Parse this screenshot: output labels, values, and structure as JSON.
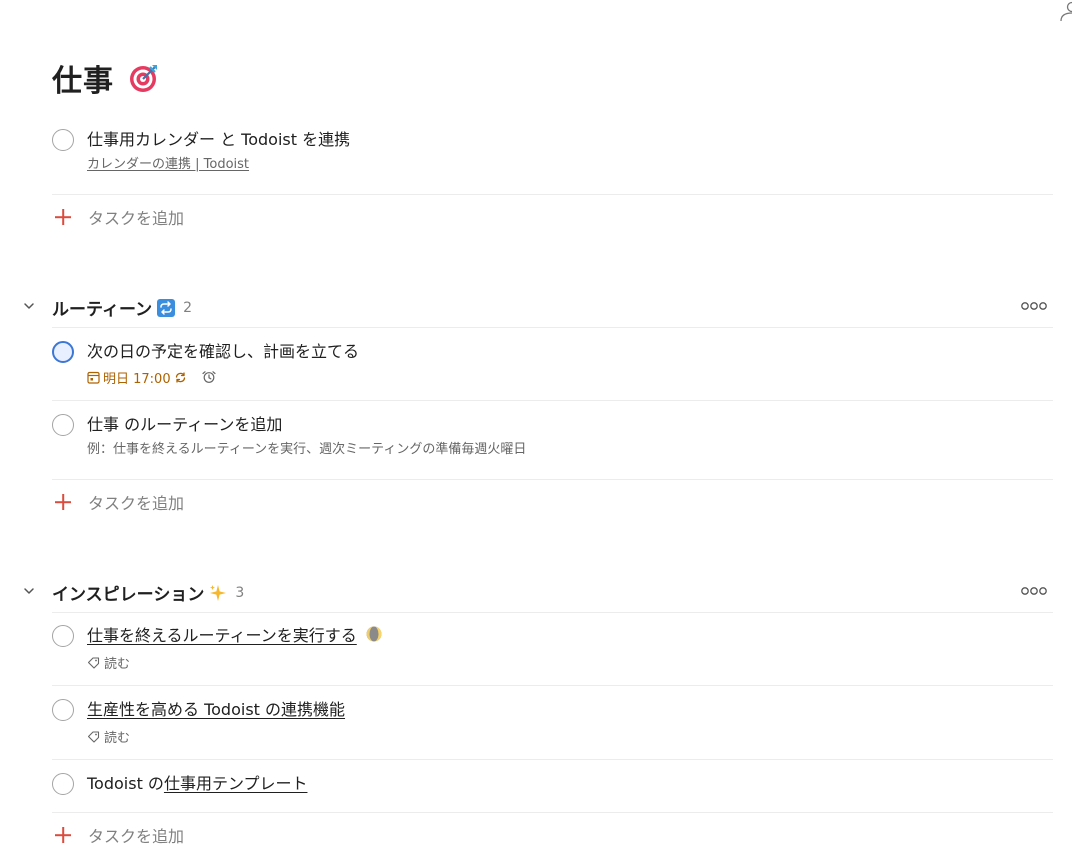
{
  "project": {
    "title": "仕事",
    "title_emoji": "direct-hit-icon"
  },
  "inbox_section": {
    "tasks": [
      {
        "title": "仕事用カレンダー と Todoist を連携",
        "subtitle": "カレンダーの連携 | Todoist"
      }
    ],
    "add_task_label": "タスクを追加"
  },
  "sections": [
    {
      "name": "ルーティーン",
      "emoji": "repeat-icon",
      "count": "2",
      "tasks": [
        {
          "title": "次の日の予定を確認し、計画を立てる",
          "priority": "p2",
          "due": "明日 17:00",
          "recurring": true,
          "reminder": true
        },
        {
          "title": "仕事 のルーティーンを追加",
          "description": "例：仕事を終えるルーティーンを実行、週次ミーティングの準備毎週火曜日"
        }
      ],
      "add_task_label": "タスクを追加"
    },
    {
      "name": "インスピレーション",
      "emoji": "sparkles-icon",
      "count": "3",
      "tasks": [
        {
          "title": "仕事を終えるルーティーンを実行する",
          "title_emoji": "moon-icon",
          "label": "読む"
        },
        {
          "title": "生産性を高める Todoist の連携機能",
          "label": "読む"
        },
        {
          "title_prefix": "Todoist の",
          "title_link": "仕事用テンプレート"
        }
      ],
      "add_task_label": "タスクを追加"
    }
  ],
  "colors": {
    "accent": "#dc4c3e",
    "priority_2": "#3c77d6",
    "due_date": "#ad6200",
    "divider": "#ececec"
  }
}
